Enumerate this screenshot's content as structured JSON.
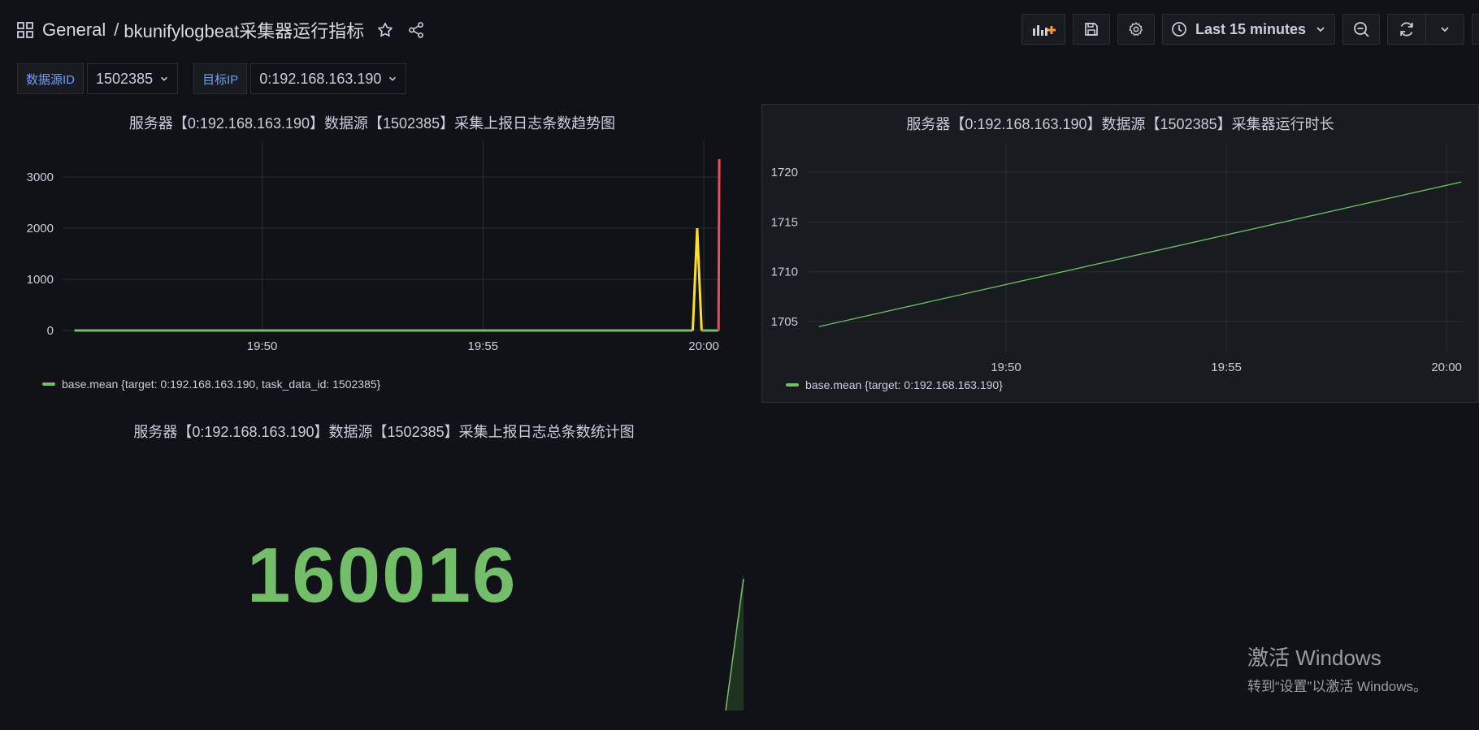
{
  "breadcrumb": {
    "folder": "General",
    "separator": "/",
    "dashboard": "bkunifylogbeat采集器运行指标"
  },
  "toolbar": {
    "time_range": "Last 15 minutes",
    "icons": [
      "add-panel-icon",
      "save-icon",
      "gear-icon",
      "clock-icon",
      "chevron-down-icon",
      "zoom-out-icon",
      "refresh-icon",
      "chevron-down-icon",
      "tv-icon"
    ]
  },
  "variables": [
    {
      "label": "数据源ID",
      "value": "1502385"
    },
    {
      "label": "目标IP",
      "value": "0:192.168.163.190"
    }
  ],
  "colors": {
    "background": "#111217",
    "panel": "#181b1f",
    "series_green": "#73bf69",
    "spike_yellow": "#fade2a",
    "spike_red": "#f2495c",
    "label_blue": "#6e9fff"
  },
  "panels": {
    "trend": {
      "title": "服务器【0:192.168.163.190】数据源【1502385】采集上报日志条数趋势图",
      "legend": "base.mean {target: 0:192.168.163.190, task_data_id: 1502385}",
      "chart_data": {
        "type": "line",
        "x_ticks": [
          "19:50",
          "19:55",
          "20:00"
        ],
        "y_ticks": [
          "0",
          "1000",
          "2000",
          "3000"
        ],
        "ylim": [
          0,
          3700
        ],
        "series": [
          {
            "name": "base.mean {target: 0:192.168.163.190, task_data_id: 1502385}",
            "points": [
              {
                "x": "19:45:45",
                "y": 0
              },
              {
                "x": "19:59:45",
                "y": 0
              },
              {
                "x": "19:59:51",
                "y": 2000
              },
              {
                "x": "19:59:57",
                "y": 0
              },
              {
                "x": "20:00:20",
                "y": 0
              },
              {
                "x": "20:00:21",
                "y": 3350
              }
            ]
          }
        ]
      }
    },
    "runtime": {
      "title": "服务器【0:192.168.163.190】数据源【1502385】采集器运行时长",
      "legend": "base.mean {target: 0:192.168.163.190}",
      "chart_data": {
        "type": "line",
        "x_ticks": [
          "19:50",
          "19:55",
          "20:00"
        ],
        "y_ticks": [
          "1705",
          "1710",
          "1715",
          "1720"
        ],
        "ylim": [
          1702,
          1723
        ],
        "series": [
          {
            "name": "base.mean {target: 0:192.168.163.190}",
            "points": [
              {
                "x": "19:45:45",
                "y": 1704.5
              },
              {
                "x": "20:00:20",
                "y": 1719
              }
            ]
          }
        ]
      }
    },
    "total": {
      "title": "服务器【0:192.168.163.190】数据源【1502385】采集上报日志总条数统计图",
      "value": "160016"
    }
  },
  "watermark": {
    "line1": "激活 Windows",
    "line2": "转到“设置”以激活 Windows。"
  }
}
